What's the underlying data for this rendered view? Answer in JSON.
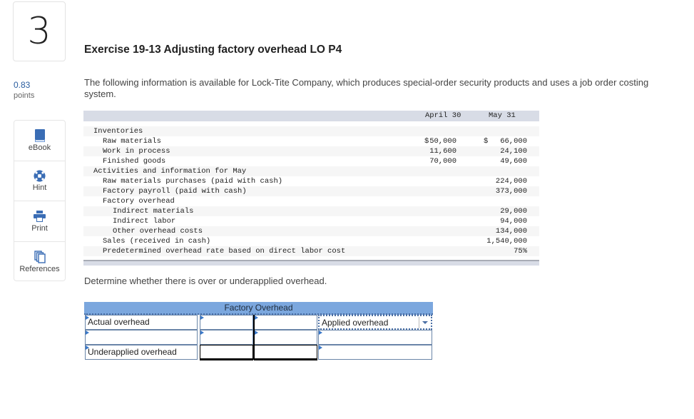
{
  "question": {
    "number": "3",
    "points_value": "0.83",
    "points_label": "points"
  },
  "tools": [
    {
      "label": "eBook",
      "icon": "book-icon"
    },
    {
      "label": "Hint",
      "icon": "lifebuoy-icon"
    },
    {
      "label": "Print",
      "icon": "printer-icon"
    },
    {
      "label": "References",
      "icon": "copy-icon"
    }
  ],
  "exercise": {
    "title": "Exercise 19-13 Adjusting factory overhead LO P4",
    "intro": "The following information is available for Lock-Tite Company, which produces special-order security products and uses a job order costing system."
  },
  "info_table": {
    "headers": {
      "col1": "April 30",
      "col2": "May 31"
    },
    "rows": [
      {
        "label": "Inventories",
        "indent": 0,
        "c1": "",
        "c2": "",
        "c1_dollar": "",
        "c2_dollar": ""
      },
      {
        "label": "Raw materials",
        "indent": 1,
        "c1": "50,000",
        "c2": "66,000",
        "c1_dollar": "$",
        "c2_dollar": "$"
      },
      {
        "label": "Work in process",
        "indent": 1,
        "c1": "11,600",
        "c2": "24,100",
        "c1_dollar": "",
        "c2_dollar": ""
      },
      {
        "label": "Finished goods",
        "indent": 1,
        "c1": "70,000",
        "c2": "49,600",
        "c1_dollar": "",
        "c2_dollar": ""
      },
      {
        "label": "Activities and information for May",
        "indent": 0,
        "c1": "",
        "c2": "",
        "c1_dollar": "",
        "c2_dollar": ""
      },
      {
        "label": "Raw materials purchases (paid with cash)",
        "indent": 1,
        "c1": "",
        "c2": "224,000",
        "c1_dollar": "",
        "c2_dollar": ""
      },
      {
        "label": "Factory payroll (paid with cash)",
        "indent": 1,
        "c1": "",
        "c2": "373,000",
        "c1_dollar": "",
        "c2_dollar": ""
      },
      {
        "label": "Factory overhead",
        "indent": 1,
        "c1": "",
        "c2": "",
        "c1_dollar": "",
        "c2_dollar": ""
      },
      {
        "label": "Indirect materials",
        "indent": 2,
        "c1": "",
        "c2": "29,000",
        "c1_dollar": "",
        "c2_dollar": ""
      },
      {
        "label": "Indirect labor",
        "indent": 2,
        "c1": "",
        "c2": "94,000",
        "c1_dollar": "",
        "c2_dollar": ""
      },
      {
        "label": "Other overhead costs",
        "indent": 2,
        "c1": "",
        "c2": "134,000",
        "c1_dollar": "",
        "c2_dollar": ""
      },
      {
        "label": "Sales (received in cash)",
        "indent": 1,
        "c1": "",
        "c2": "1,540,000",
        "c1_dollar": "",
        "c2_dollar": ""
      },
      {
        "label": "Predetermined overhead rate based on direct labor cost",
        "indent": 1,
        "c1": "",
        "c2": "75%",
        "c1_dollar": "",
        "c2_dollar": ""
      }
    ]
  },
  "prompt": "Determine whether there is over or underapplied overhead.",
  "t_account": {
    "title": "Factory Overhead",
    "rows": [
      {
        "left_label": "Actual overhead",
        "debit": "",
        "credit": "",
        "right_label": "Applied overhead",
        "right_is_dropdown": true
      },
      {
        "left_label": "",
        "debit": "",
        "credit": "",
        "right_label": "",
        "right_is_dropdown": false
      },
      {
        "left_label": "Underapplied overhead",
        "debit": "",
        "credit": "",
        "right_label": "",
        "right_is_dropdown": false
      }
    ]
  },
  "colors": {
    "accent": "#2a5d9f",
    "t_header": "#7ba7de",
    "table_header": "#d8dce6"
  }
}
